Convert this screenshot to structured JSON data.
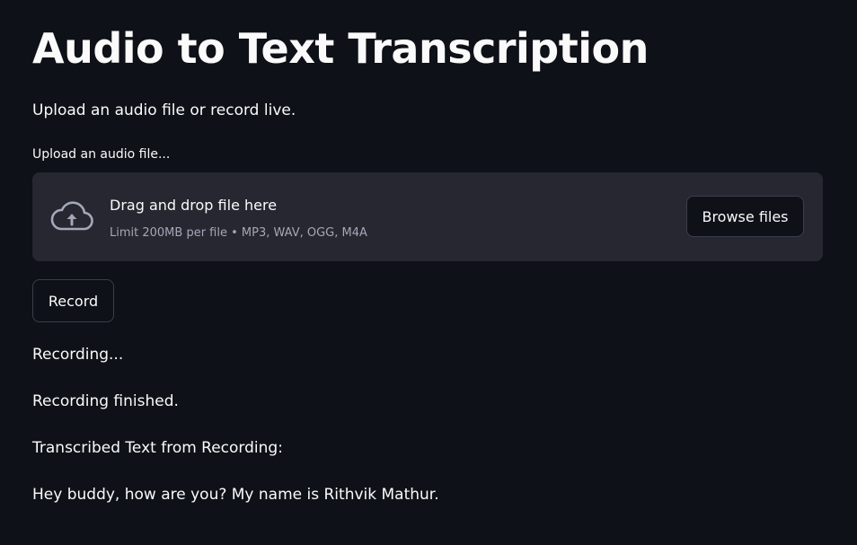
{
  "page": {
    "title": "Audio to Text Transcription",
    "subtitle": "Upload an audio file or record live."
  },
  "uploader": {
    "label": "Upload an audio file...",
    "dropzone_title": "Drag and drop file here",
    "dropzone_limit": "Limit 200MB per file • MP3, WAV, OGG, M4A",
    "browse_label": "Browse files",
    "icon": "cloud-upload-icon"
  },
  "record": {
    "button_label": "Record"
  },
  "status": {
    "recording": "Recording...",
    "finished": "Recording finished.",
    "transcribed_heading": "Transcribed Text from Recording:",
    "transcribed_text": "Hey buddy, how are you? My name is Rithvik Mathur."
  },
  "colors": {
    "background": "#0e1117",
    "surface": "#262730",
    "text": "#fafafa",
    "muted_text": "#a3a8b8",
    "border": "#3b3e4a"
  }
}
